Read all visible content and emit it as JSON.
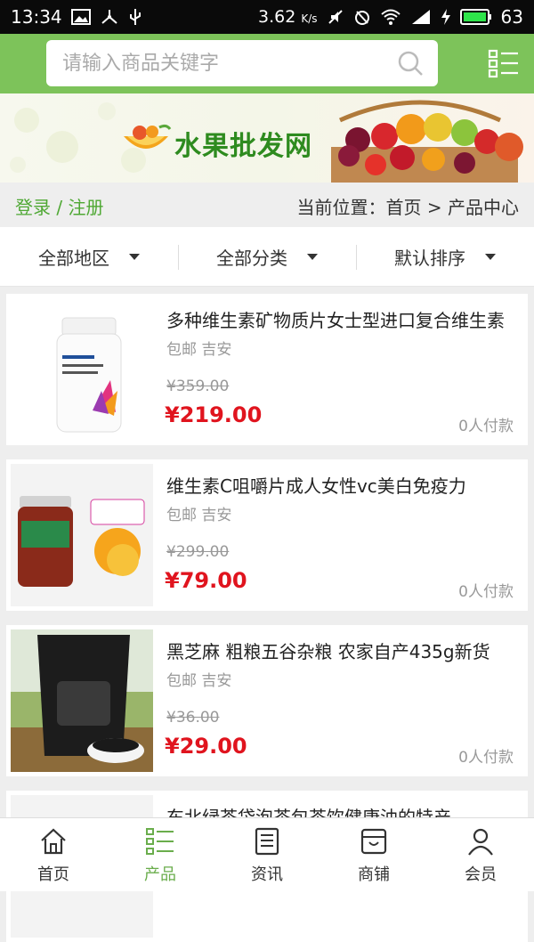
{
  "statusbar": {
    "time": "13:34",
    "speed": "3.62",
    "speed_unit": "K/s",
    "battery": "63"
  },
  "search": {
    "placeholder": "请输入商品关键字"
  },
  "banner": {
    "title": "水果批发网"
  },
  "breadcrumb": {
    "login": "登录 / 注册",
    "location": "当前位置：首页 > 产品中心"
  },
  "filters": [
    {
      "label": "全部地区"
    },
    {
      "label": "全部分类"
    },
    {
      "label": "默认排序"
    }
  ],
  "products": [
    {
      "name": "多种维生素矿物质片女士型进口复合维生素",
      "tags": "包邮 吉安",
      "old_price": "¥359.00",
      "price": "¥219.00",
      "sold": "0人付款"
    },
    {
      "name": "维生素C咀嚼片成人女性vc美白免疫力",
      "tags": "包邮 吉安",
      "old_price": "¥299.00",
      "price": "¥79.00",
      "sold": "0人付款"
    },
    {
      "name": "黑芝麻 粗粮五谷杂粮 农家自产435g新货",
      "tags": "包邮 吉安",
      "old_price": "¥36.00",
      "price": "¥29.00",
      "sold": "0人付款"
    },
    {
      "name": "东北绿茶袋泡茶包茶饮健康油的特产",
      "tags": "",
      "old_price": "",
      "price": "",
      "sold": ""
    }
  ],
  "tabbar": [
    {
      "label": "首页",
      "icon": "home-icon"
    },
    {
      "label": "产品",
      "icon": "list-icon"
    },
    {
      "label": "资讯",
      "icon": "news-icon"
    },
    {
      "label": "商铺",
      "icon": "store-icon"
    },
    {
      "label": "会员",
      "icon": "user-icon"
    }
  ],
  "colors": {
    "header": "#7dc35a",
    "price": "#e0141e",
    "active": "#6aad4c"
  }
}
